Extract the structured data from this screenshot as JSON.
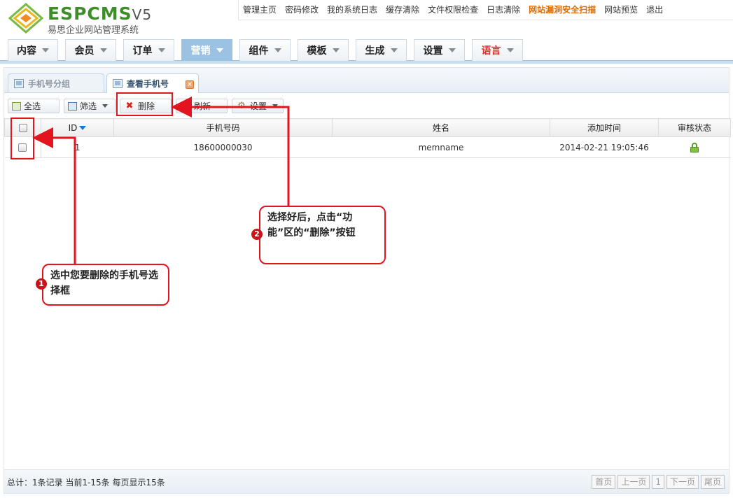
{
  "brand": {
    "logo_text": "ESPCMS",
    "version": "V5",
    "subtitle": "易思企业网站管理系统"
  },
  "top_nav": [
    {
      "label": "管理主页",
      "highlight": false
    },
    {
      "label": "密码修改",
      "highlight": false
    },
    {
      "label": "我的系统日志",
      "highlight": false
    },
    {
      "label": "缓存清除",
      "highlight": false
    },
    {
      "label": "文件权限检查",
      "highlight": false
    },
    {
      "label": "日志清除",
      "highlight": false
    },
    {
      "label": "网站漏洞安全扫描",
      "highlight": true
    },
    {
      "label": "网站预览",
      "highlight": false
    },
    {
      "label": "退出",
      "highlight": false
    }
  ],
  "main_nav": [
    {
      "label": "内容",
      "active": false,
      "red": false
    },
    {
      "label": "会员",
      "active": false,
      "red": false
    },
    {
      "label": "订单",
      "active": false,
      "red": false
    },
    {
      "label": "营销",
      "active": true,
      "red": false
    },
    {
      "label": "组件",
      "active": false,
      "red": false
    },
    {
      "label": "模板",
      "active": false,
      "red": false
    },
    {
      "label": "生成",
      "active": false,
      "red": false
    },
    {
      "label": "设置",
      "active": false,
      "red": false
    },
    {
      "label": "语言",
      "active": false,
      "red": true
    }
  ],
  "tabs": [
    {
      "label": "手机号分组",
      "active": false
    },
    {
      "label": "查看手机号",
      "active": true
    }
  ],
  "toolbar": {
    "select_all": "全选",
    "filter": "筛选",
    "delete": "删除",
    "refresh": "刷新",
    "settings": "设置"
  },
  "table": {
    "columns": [
      "ID",
      "手机号码",
      "姓名",
      "添加时间",
      "审核状态"
    ],
    "rows": [
      {
        "id": "1",
        "phone": "18600000030",
        "name": "memname",
        "added": "2014-02-21 19:05:46",
        "status_icon": "unlocked-icon"
      }
    ]
  },
  "footer": {
    "summary": "总计：1条记录 当前1-15条 每页显示15条",
    "pager": [
      "首页",
      "上一页",
      "1",
      "下一页",
      "尾页"
    ]
  },
  "annotations": {
    "step1_number": "1",
    "step1_text": "选中您要删除的手机号选择框",
    "step2_number": "2",
    "step2_text": "选择好后，点击“功能”区的“删除”按钮",
    "color": "#e3141d"
  },
  "colors": {
    "accent": "#9bc1e3",
    "brand_green": "#3e8d2a",
    "highlight_orange": "#e06c00",
    "annotation_red": "#e3141d"
  }
}
